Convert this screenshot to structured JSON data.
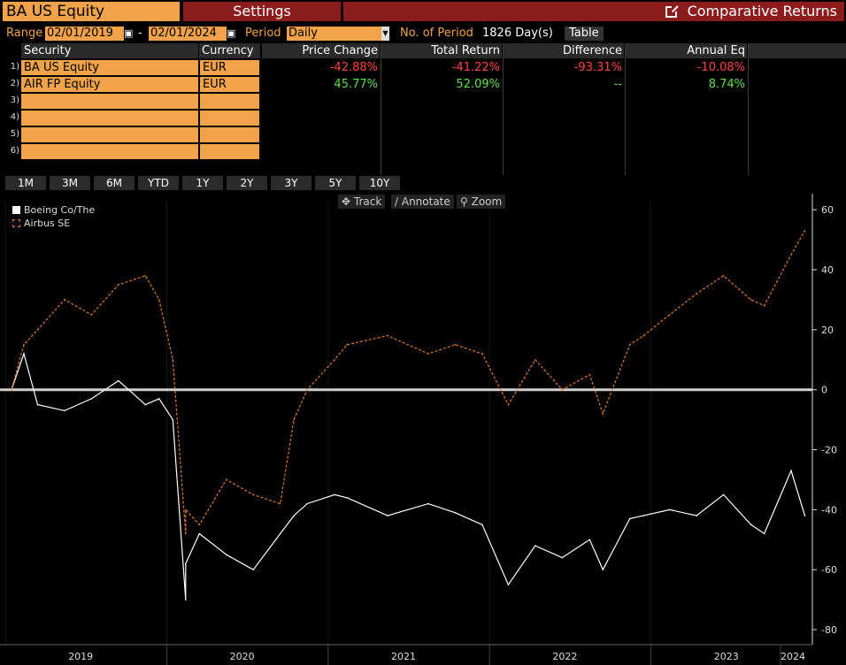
{
  "header": {
    "security": "BA US Equity",
    "settings_tab": "Settings",
    "function_title": "Comparative Returns"
  },
  "controls": {
    "range_label": "Range",
    "start_date": "02/01/2019",
    "dash": "-",
    "end_date": "02/01/2024",
    "period_label": "Period",
    "period_value": "Daily",
    "num_period_label": "No. of Period",
    "num_period_value": "1826 Day(s)",
    "table_button": "Table"
  },
  "table": {
    "columns": [
      "Security",
      "Currency",
      "Price Change",
      "Total Return",
      "Difference",
      "Annual Eq"
    ],
    "rows": [
      {
        "n": "1)",
        "security": "BA US Equity",
        "currency": "EUR",
        "price_change": "-42.88%",
        "total_return": "-41.22%",
        "difference": "-93.31%",
        "annual_eq": "-10.08%"
      },
      {
        "n": "2)",
        "security": "AIR FP Equity",
        "currency": "EUR",
        "price_change": "45.77%",
        "total_return": "52.09%",
        "difference": "--",
        "annual_eq": "8.74%"
      },
      {
        "n": "3)",
        "security": "",
        "currency": ""
      },
      {
        "n": "4)",
        "security": "",
        "currency": ""
      },
      {
        "n": "5)",
        "security": "",
        "currency": ""
      },
      {
        "n": "6)",
        "security": "",
        "currency": ""
      }
    ]
  },
  "periods": [
    "1M",
    "3M",
    "6M",
    "YTD",
    "1Y",
    "2Y",
    "3Y",
    "5Y",
    "10Y"
  ],
  "chart_tools": {
    "track": "Track",
    "annotate": "Annotate",
    "zoom": "Zoom"
  },
  "chart_data": {
    "type": "line",
    "ylim": [
      -85,
      63
    ],
    "y_ticks": [
      60,
      40,
      20,
      0,
      -20,
      -40,
      -60,
      -80
    ],
    "x_tick_labels": [
      "2019",
      "2020",
      "2021",
      "2022",
      "2023",
      "2024"
    ],
    "series": [
      {
        "name": "Boeing Co/The",
        "color": "#ffffff",
        "style": "solid",
        "x": [
          "2019-02",
          "2019-03",
          "2019-04",
          "2019-06",
          "2019-08",
          "2019-10",
          "2019-12",
          "2020-01",
          "2020-02",
          "2020-03",
          "2020-03",
          "2020-04",
          "2020-06",
          "2020-08",
          "2020-10",
          "2020-11",
          "2020-12",
          "2021-02",
          "2021-03",
          "2021-06",
          "2021-09",
          "2021-11",
          "2022-01",
          "2022-03",
          "2022-05",
          "2022-07",
          "2022-09",
          "2022-10",
          "2022-12",
          "2023-01",
          "2023-03",
          "2023-05",
          "2023-07",
          "2023-09",
          "2023-10",
          "2023-12",
          "2024-01"
        ],
        "values": [
          0,
          12,
          -5,
          -7,
          -3,
          3,
          -5,
          -3,
          -10,
          -70,
          -58,
          -48,
          -55,
          -60,
          -48,
          -42,
          -38,
          -35,
          -36,
          -42,
          -38,
          -41,
          -45,
          -65,
          -52,
          -56,
          -50,
          -60,
          -43,
          -42,
          -40,
          -42,
          -35,
          -45,
          -48,
          -27,
          -42
        ]
      },
      {
        "name": "Airbus SE",
        "color": "#e0782a",
        "style": "dashed",
        "x": [
          "2019-02",
          "2019-03",
          "2019-04",
          "2019-06",
          "2019-08",
          "2019-10",
          "2019-12",
          "2020-01",
          "2020-02",
          "2020-03",
          "2020-03",
          "2020-04",
          "2020-06",
          "2020-08",
          "2020-10",
          "2020-11",
          "2020-12",
          "2021-02",
          "2021-03",
          "2021-06",
          "2021-09",
          "2021-11",
          "2022-01",
          "2022-03",
          "2022-05",
          "2022-07",
          "2022-09",
          "2022-10",
          "2022-12",
          "2023-01",
          "2023-03",
          "2023-05",
          "2023-07",
          "2023-09",
          "2023-10",
          "2023-12",
          "2024-01"
        ],
        "values": [
          0,
          15,
          20,
          30,
          25,
          35,
          38,
          30,
          10,
          -48,
          -40,
          -45,
          -30,
          -35,
          -38,
          -10,
          0,
          10,
          15,
          18,
          12,
          15,
          12,
          -5,
          10,
          0,
          5,
          -8,
          15,
          18,
          25,
          32,
          38,
          30,
          28,
          45,
          53
        ]
      }
    ]
  }
}
